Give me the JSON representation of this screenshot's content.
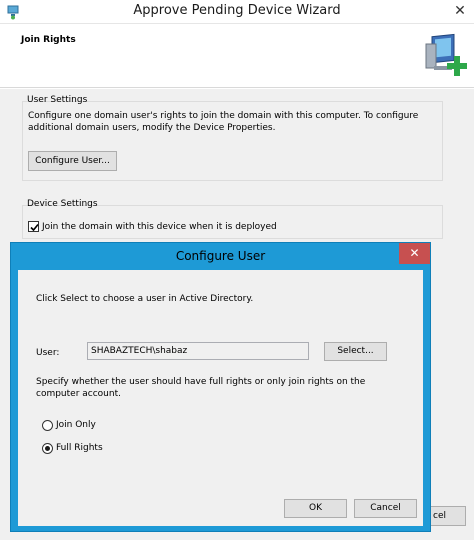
{
  "window": {
    "title": "Approve Pending Device Wizard",
    "close_glyph": "✕"
  },
  "header": {
    "page_title": "Join Rights",
    "icon": "computer-add-icon"
  },
  "user_settings": {
    "title": "User Settings",
    "description": "Configure one domain user's rights to join the domain with this computer. To configure additional domain users, modify the Device Properties.",
    "configure_button": "Configure User..."
  },
  "device_settings": {
    "title": "Device Settings",
    "join_checkbox_label": "Join the domain with this device when it is deployed",
    "join_checked": true
  },
  "wizard_footer": {
    "cancel_partial": "cel"
  },
  "dialog": {
    "title": "Configure User",
    "close_glyph": "✕",
    "instruction": "Click Select to choose a user in Active Directory.",
    "user_label": "User:",
    "user_value": "SHABAZTECH\\shabaz",
    "select_button": "Select...",
    "rights_instruction": "Specify whether the user should have full rights or only join rights on the computer account.",
    "options": [
      {
        "label": "Join Only",
        "selected": false
      },
      {
        "label": "Full Rights",
        "selected": true
      }
    ],
    "ok_button": "OK",
    "cancel_button": "Cancel"
  },
  "colors": {
    "dialog_frame": "#1e9ad6",
    "close_button": "#c75050",
    "body_bg": "#f0f0f0"
  }
}
